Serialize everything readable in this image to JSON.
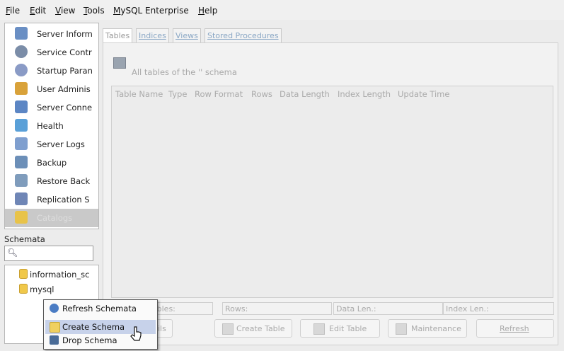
{
  "menu": [
    "File",
    "Edit",
    "View",
    "Tools",
    "MySQL Enterprise",
    "Help"
  ],
  "sidebar": {
    "items": [
      {
        "label": "Server Inform",
        "icon": "server-info-icon",
        "color": "#6a8fc4"
      },
      {
        "label": "Service Contr",
        "icon": "service-control-icon",
        "color": "#7b8da8"
      },
      {
        "label": "Startup Paran",
        "icon": "startup-parameters-icon",
        "color": "#8a9bc6"
      },
      {
        "label": "User Adminis",
        "icon": "users-icon",
        "color": "#d9a23a"
      },
      {
        "label": "Server Conne",
        "icon": "connections-icon",
        "color": "#5c86c4"
      },
      {
        "label": "Health",
        "icon": "health-icon",
        "color": "#5aa0d8"
      },
      {
        "label": "Server Logs",
        "icon": "logs-icon",
        "color": "#7f9fcf"
      },
      {
        "label": "Backup",
        "icon": "backup-icon",
        "color": "#6c8fb8"
      },
      {
        "label": "Restore Back",
        "icon": "restore-icon",
        "color": "#7f9cbc"
      },
      {
        "label": "Replication S",
        "icon": "replication-icon",
        "color": "#6f86b6"
      },
      {
        "label": "Catalogs",
        "icon": "catalogs-folder-icon",
        "color": "#e8c34a",
        "selected": true
      }
    ]
  },
  "schemata": {
    "label": "Schemata",
    "search_placeholder": "",
    "items": [
      "information_sc",
      "mysql"
    ]
  },
  "tabs": [
    {
      "label": "Tables",
      "active": true
    },
    {
      "label": "Indices"
    },
    {
      "label": "Views"
    },
    {
      "label": "Stored Procedures"
    }
  ],
  "panel": {
    "title": "All tables of the '' schema",
    "columns": [
      "Table Name",
      "Type",
      "Row Format",
      "Rows",
      "Data Length",
      "Index Length",
      "Update Time"
    ]
  },
  "stats": {
    "tables": "Tables:",
    "rows": "Rows:",
    "data_len": "Data Len.:",
    "index_len": "Index Len.:"
  },
  "buttons": {
    "details": "ils",
    "create_table": "Create Table",
    "edit_table": "Edit Table",
    "maintenance": "Maintenance",
    "refresh": "Refresh"
  },
  "context_menu": [
    {
      "label": "Refresh Schemata",
      "icon": "refresh-icon",
      "color": "#4a7cc4"
    },
    {
      "label": "Create Schema",
      "icon": "create-schema-icon",
      "color": "#f0d060",
      "highlighted": true
    },
    {
      "label": "Drop Schema",
      "icon": "drop-schema-icon",
      "color": "#4a6c98"
    }
  ]
}
